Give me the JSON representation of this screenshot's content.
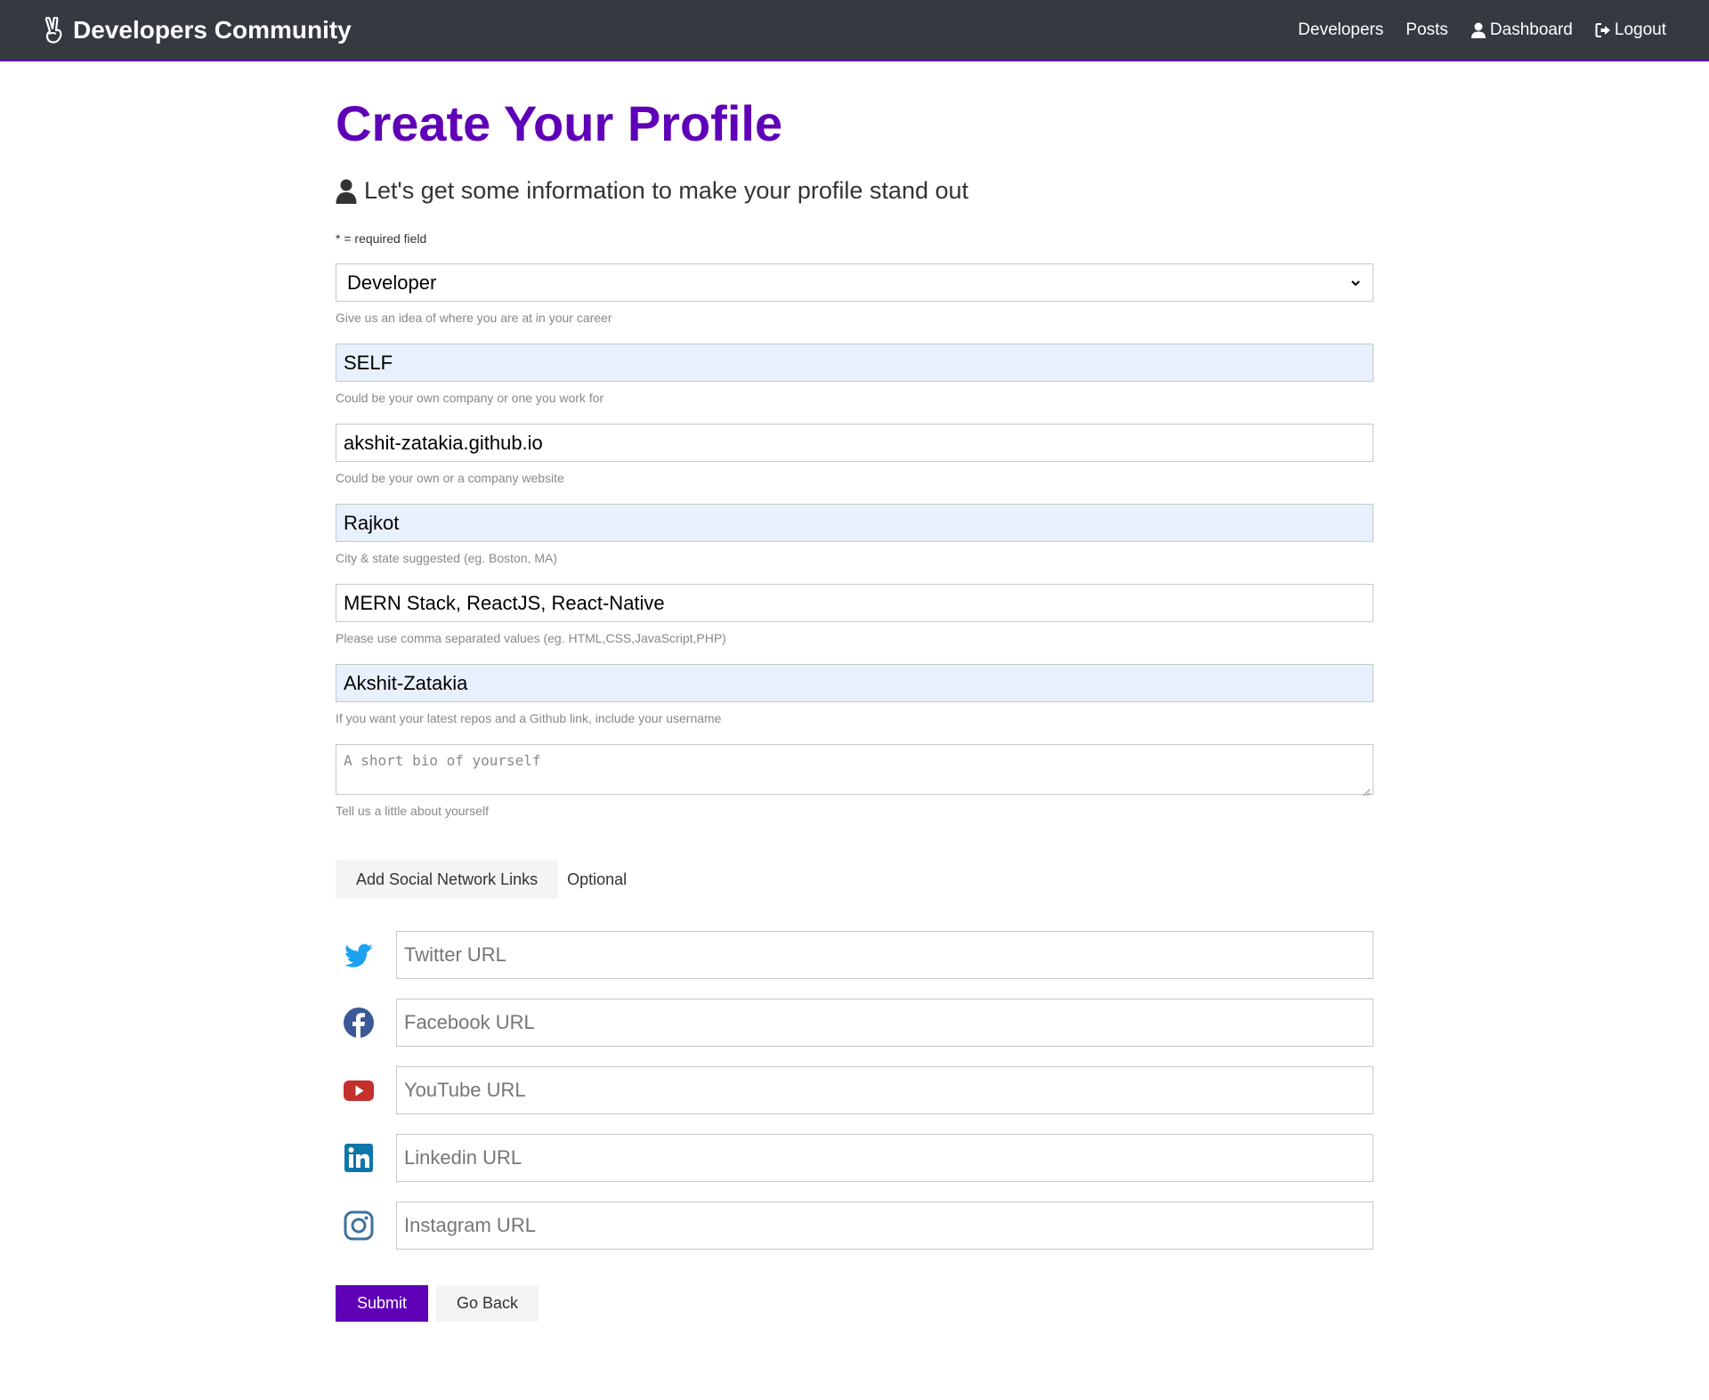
{
  "navbar": {
    "brand": "Developers Community",
    "links": {
      "developers": "Developers",
      "posts": "Posts",
      "dashboard": "Dashboard",
      "logout": "Logout"
    }
  },
  "page": {
    "title": "Create Your Profile",
    "lead": "Let's get some information to make your profile stand out",
    "required_note": "* = required field"
  },
  "form": {
    "status": {
      "value": "Developer",
      "help": "Give us an idea of where you are at in your career"
    },
    "company": {
      "value": "SELF",
      "help": "Could be your own company or one you work for"
    },
    "website": {
      "value": "akshit-zatakia.github.io",
      "help": "Could be your own or a company website"
    },
    "location": {
      "value": "Rajkot",
      "help": "City & state suggested (eg. Boston, MA)"
    },
    "skills": {
      "value": "MERN Stack, ReactJS, React-Native",
      "help": "Please use comma separated values (eg. HTML,CSS,JavaScript,PHP)"
    },
    "github": {
      "value": "Akshit-Zatakia",
      "help": "If you want your latest repos and a Github link, include your username"
    },
    "bio": {
      "placeholder": "A short bio of yourself",
      "help": "Tell us a little about yourself"
    },
    "social_toggle": "Add Social Network Links",
    "optional": "Optional",
    "social": {
      "twitter": "Twitter URL",
      "facebook": "Facebook URL",
      "youtube": "YouTube URL",
      "linkedin": "Linkedin URL",
      "instagram": "Instagram URL"
    },
    "submit": "Submit",
    "go_back": "Go Back"
  },
  "colors": {
    "navbar_bg": "#343a40",
    "primary": "#5f00b8",
    "autofill_bg": "#e8f0fe",
    "twitter": "#1da1f2",
    "facebook": "#3b5998",
    "youtube": "#c4302b",
    "linkedin": "#0e76a8",
    "instagram": "#3f729b"
  }
}
